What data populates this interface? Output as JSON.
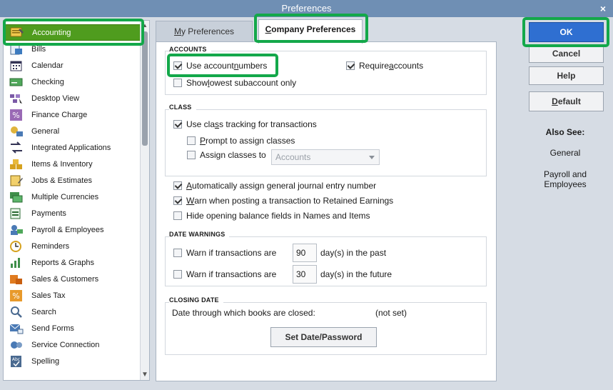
{
  "window": {
    "title": "Preferences",
    "close_glyph": "×"
  },
  "sidebar": {
    "items": [
      {
        "label": "Accounting",
        "icon": "accounting-icon"
      },
      {
        "label": "Bills",
        "icon": "bills-icon"
      },
      {
        "label": "Calendar",
        "icon": "calendar-icon"
      },
      {
        "label": "Checking",
        "icon": "checking-icon"
      },
      {
        "label": "Desktop View",
        "icon": "desktop-view-icon"
      },
      {
        "label": "Finance Charge",
        "icon": "finance-charge-icon"
      },
      {
        "label": "General",
        "icon": "general-icon"
      },
      {
        "label": "Integrated Applications",
        "icon": "integrated-apps-icon"
      },
      {
        "label": "Items & Inventory",
        "icon": "items-inventory-icon"
      },
      {
        "label": "Jobs & Estimates",
        "icon": "jobs-estimates-icon"
      },
      {
        "label": "Multiple Currencies",
        "icon": "multiple-currencies-icon"
      },
      {
        "label": "Payments",
        "icon": "payments-icon"
      },
      {
        "label": "Payroll & Employees",
        "icon": "payroll-icon"
      },
      {
        "label": "Reminders",
        "icon": "reminders-icon"
      },
      {
        "label": "Reports & Graphs",
        "icon": "reports-graphs-icon"
      },
      {
        "label": "Sales & Customers",
        "icon": "sales-customers-icon"
      },
      {
        "label": "Sales Tax",
        "icon": "sales-tax-icon"
      },
      {
        "label": "Search",
        "icon": "search-icon"
      },
      {
        "label": "Send Forms",
        "icon": "send-forms-icon"
      },
      {
        "label": "Service Connection",
        "icon": "service-connection-icon"
      },
      {
        "label": "Spelling",
        "icon": "spelling-icon"
      }
    ],
    "active_index": 0
  },
  "tabs": {
    "my_prefs": {
      "first": "M",
      "rest": "y Preferences"
    },
    "company_prefs": {
      "first": "C",
      "rest": "ompany Preferences"
    }
  },
  "accounts": {
    "title": "ACCOUNTS",
    "use_numbers": {
      "pre": "Use account ",
      "ul": "n",
      "post": "umbers",
      "checked": true
    },
    "require": {
      "pre": "Require ",
      "ul": "a",
      "post": "ccounts",
      "checked": true
    },
    "show_lowest": {
      "pre": "Show ",
      "ul": "l",
      "post": "owest subaccount only",
      "checked": false
    }
  },
  "class": {
    "title": "CLASS",
    "use_tracking": {
      "pre": "Use cla",
      "ul": "s",
      "post": "s tracking for transactions",
      "checked": true
    },
    "prompt": {
      "pre": "",
      "ul": "P",
      "post": "rompt to assign classes",
      "checked": false
    },
    "assign": {
      "pre": "Assi",
      "ul": "g",
      "post": "n classes to",
      "checked": false
    },
    "assign_select": "Accounts"
  },
  "general_opts": {
    "auto_assign": {
      "pre": "",
      "ul": "A",
      "post": "utomatically assign general journal entry number",
      "checked": true
    },
    "warn_retained": {
      "pre": "",
      "ul": "W",
      "post": "arn when posting a transaction to Retained Earnings",
      "checked": true
    },
    "hide_opening": {
      "pre": "Hide opening balance fields in Names and Items",
      "ul": "",
      "post": "",
      "checked": false
    }
  },
  "date_warnings": {
    "title": "DATE WARNINGS",
    "past": {
      "label": "Warn if transactions are",
      "value": "90",
      "suffix": "day(s) in the past",
      "checked": false
    },
    "future": {
      "label": "Warn if transactions are",
      "value": "30",
      "suffix": "day(s) in the future",
      "checked": false
    }
  },
  "closing": {
    "title": "CLOSING DATE",
    "label": "Date through which books are closed:",
    "value": "(not set)",
    "button": "Set Date/Password"
  },
  "buttons": {
    "ok": "OK",
    "cancel": "Cancel",
    "help": "Help",
    "default_first": "D",
    "default_rest": "efault"
  },
  "also_see": {
    "title": "Also See:",
    "links": [
      "General",
      "Payroll and Employees"
    ]
  },
  "colors": {
    "highlight": "#13a84a",
    "active_item": "#4f9c1e",
    "ok_button": "#2f6fd1"
  }
}
